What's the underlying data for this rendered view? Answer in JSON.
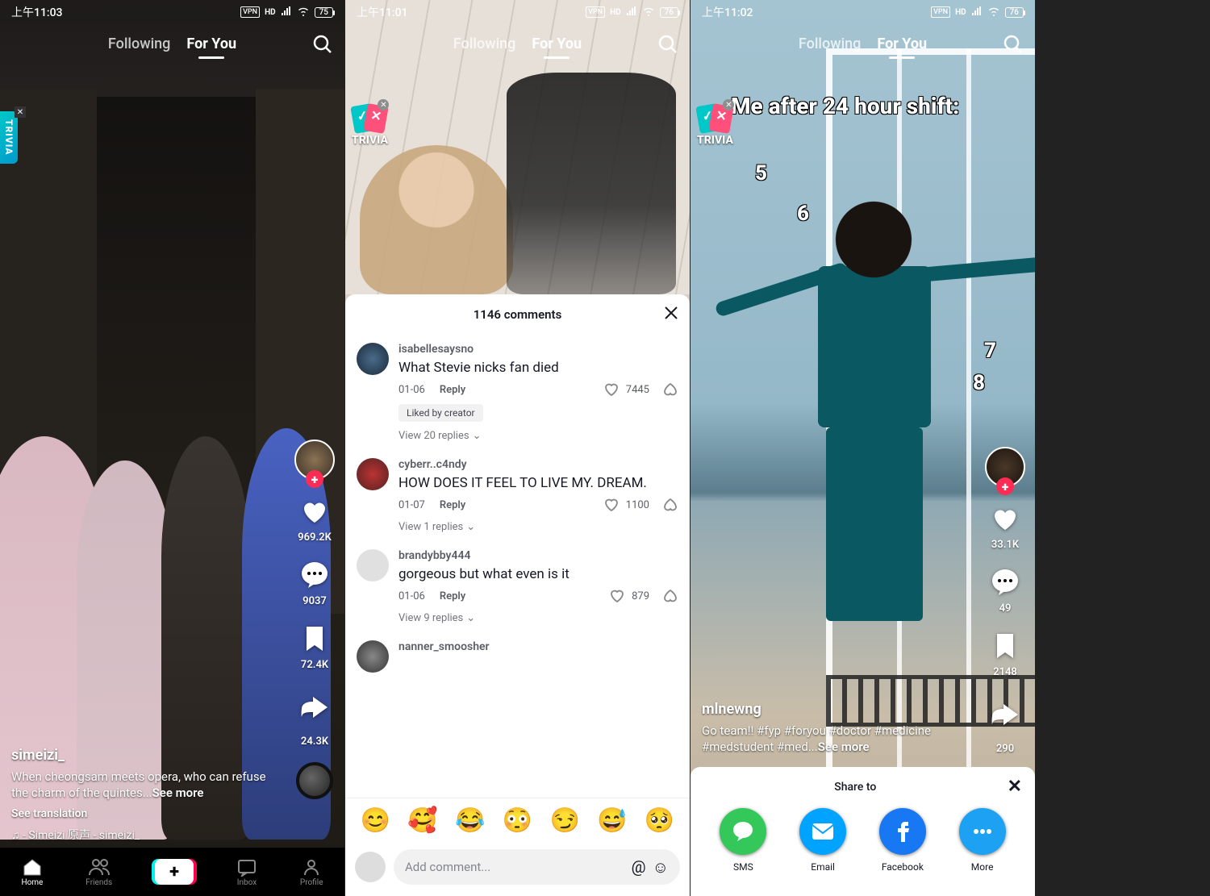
{
  "phones": [
    {
      "status": {
        "time": "上午11:03",
        "vpn": "VPN",
        "hd": "HD",
        "battery": "75"
      },
      "tabs": {
        "following": "Following",
        "forYou": "For You"
      },
      "trivia": "TRIVIA",
      "actions": {
        "likes": "969.2K",
        "comments": "9037",
        "bookmarks": "72.4K",
        "shares": "24.3K"
      },
      "info": {
        "username": "simeizi_",
        "caption": "When cheongsam meets opera, who can refuse the charm of the quintes...",
        "seeMore": "See more",
        "translate": "See translation",
        "sound": "♫ - Simeizi  原声 - simeizi_"
      },
      "nav": {
        "home": "Home",
        "friends": "Friends",
        "inbox": "Inbox",
        "profile": "Profile"
      }
    },
    {
      "status": {
        "time": "上午11:01",
        "vpn": "VPN",
        "hd": "HD",
        "battery": "76"
      },
      "tabs": {
        "following": "Following",
        "forYou": "For You"
      },
      "trivia": "TRIVIA",
      "commentsSheet": {
        "title": "1146 comments",
        "likedBy": "Liked by creator",
        "reply": "Reply",
        "placeholder": "Add comment...",
        "emojis": [
          "😊",
          "🥰",
          "😂",
          "😳",
          "😏",
          "😅",
          "🥺"
        ],
        "items": [
          {
            "user": "isabellesaysno",
            "text": "What Stevie nicks fan died",
            "date": "01-06",
            "likes": "7445",
            "viewReplies": "View 20 replies",
            "likedByCreator": true
          },
          {
            "user": "cyberr..c4ndy",
            "text": "HOW DOES IT FEEL TO LIVE MY. DREAM.",
            "date": "01-07",
            "likes": "1100",
            "viewReplies": "View 1 replies",
            "likedByCreator": false
          },
          {
            "user": "brandybby444",
            "text": "gorgeous but what even is it",
            "date": "01-06",
            "likes": "879",
            "viewReplies": "View 9 replies",
            "likedByCreator": false
          },
          {
            "user": "nanner_smoosher",
            "text": "",
            "date": "",
            "likes": "",
            "viewReplies": "",
            "likedByCreator": false
          }
        ]
      }
    },
    {
      "status": {
        "time": "上午11:02",
        "vpn": "VPN",
        "hd": "HD",
        "battery": "76"
      },
      "tabs": {
        "following": "Following",
        "forYou": "For You"
      },
      "trivia": "TRIVIA",
      "overlay": "Me after 24 hour shift:",
      "numbers": [
        "5",
        "6",
        "7",
        "8"
      ],
      "actions": {
        "likes": "33.1K",
        "comments": "49",
        "bookmarks": "2148",
        "shares": "290"
      },
      "info": {
        "username": "mlnewng",
        "caption": "Go team!! #fyp #foryou #doctor #medicine #medstudent #med...",
        "seeMore": "See more"
      },
      "share": {
        "title": "Share to",
        "items": [
          {
            "name": "SMS"
          },
          {
            "name": "Email"
          },
          {
            "name": "Facebook"
          },
          {
            "name": "More"
          }
        ]
      }
    }
  ]
}
